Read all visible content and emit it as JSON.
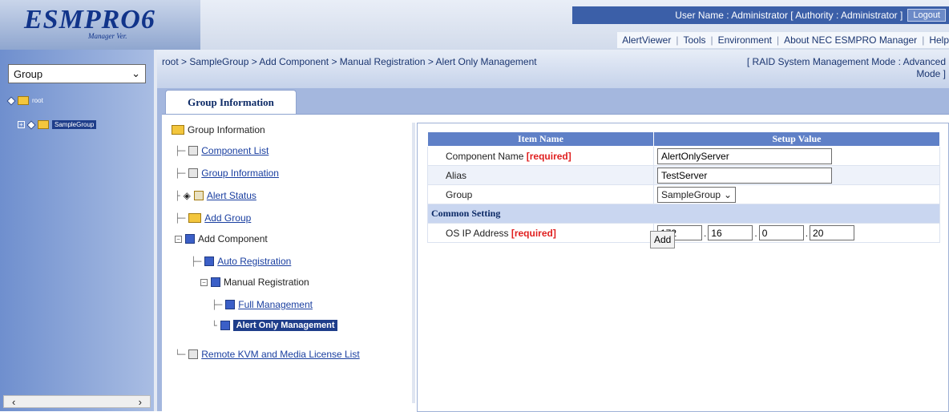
{
  "header": {
    "logo": "ESMPRO6",
    "logo_sub": "Manager Ver.",
    "user_info": "User Name : Administrator  [ Authority : Administrator ]",
    "logout_label": "Logout",
    "menu": [
      "AlertViewer",
      "Tools",
      "Environment",
      "About NEC ESMPRO Manager",
      "Help"
    ]
  },
  "sidebar": {
    "group_select": "Group",
    "tree": {
      "root": "root",
      "child": "SampleGroup"
    }
  },
  "breadcrumb": "root > SampleGroup > Add Component > Manual Registration > Alert Only Management",
  "mode_line1": "[ RAID System Management Mode : Advanced",
  "mode_line2": "Mode ]",
  "tab_label": "Group Information",
  "nav_tree": {
    "root": "Group Information",
    "component_list": "Component List",
    "group_information": "Group Information",
    "alert_status": "Alert Status",
    "add_group": "Add Group",
    "add_component": "Add Component",
    "auto_registration": "Auto Registration",
    "manual_registration": "Manual Registration",
    "full_management": "Full Management",
    "alert_only_management": "Alert Only Management",
    "remote_kvm": "Remote KVM and Media License List"
  },
  "form": {
    "col_item": "Item Name",
    "col_value": "Setup Value",
    "component_name_label": "Component Name",
    "required_tag": "[required]",
    "component_name_value": "AlertOnlyServer",
    "alias_label": "Alias",
    "alias_value": "TestServer",
    "group_label": "Group",
    "group_value": "SampleGroup",
    "common_setting": "Common Setting",
    "os_ip_label": "OS IP Address",
    "ip": [
      "172",
      "16",
      "0",
      "20"
    ],
    "add_label": "Add"
  }
}
